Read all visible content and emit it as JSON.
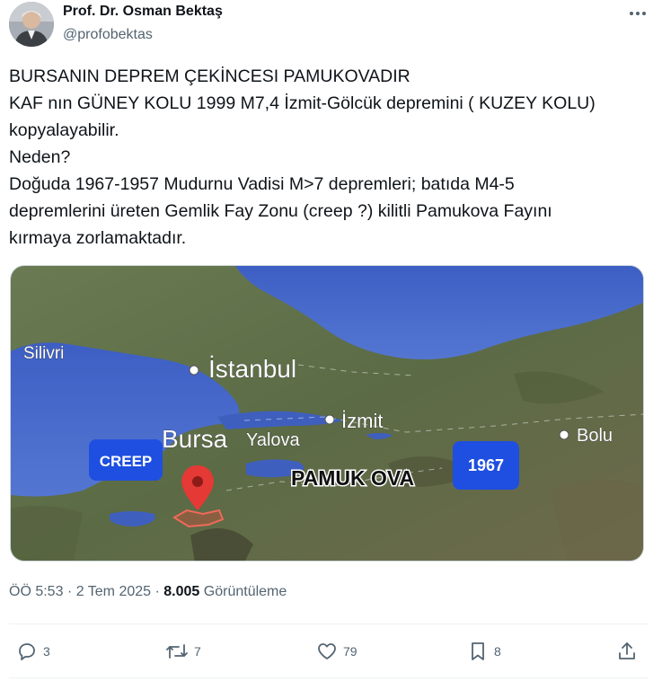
{
  "author": {
    "name": "Prof. Dr. Osman Bektaş",
    "handle": "@profobektas"
  },
  "tweet": {
    "lines": [
      "BURSANIN DEPREM ÇEKİNCESI PAMUKOVADIR",
      "KAF nın GÜNEY KOLU 1999 M7,4 İzmit-Gölcük depremini ( KUZEY KOLU)",
      "kopyalayabilir.",
      "Neden?",
      "Doğuda 1967-1957 Mudurnu Vadisi M>7 depremleri; batıda M4-5",
      "depremlerini üreten Gemlik Fay Zonu (creep ?) kilitli Pamukova Fayını",
      "kırmaya zorlamaktadır."
    ]
  },
  "map": {
    "labels": {
      "silivri": "Silivri",
      "istanbul": "İstanbul",
      "izmit": "İzmit",
      "bursa": "Bursa",
      "yalova": "Yalova",
      "bolu": "Bolu",
      "pamukova": "PAMUK OVA",
      "creep": "CREEP",
      "year": "1967"
    },
    "colors": {
      "sea": "#4a6bc9",
      "land": "#5b6b45",
      "badge": "#1f4fe0",
      "pin": "#e53935"
    }
  },
  "meta": {
    "time": "ÖÖ 5:53",
    "separator": "·",
    "date": "2 Tem 2025",
    "views_count": "8.005",
    "views_label": "Görüntüleme"
  },
  "actions": {
    "replies": "3",
    "reposts": "7",
    "likes": "79",
    "bookmarks": "8"
  },
  "icons": [
    "more-icon",
    "reply-icon",
    "repost-icon",
    "like-icon",
    "bookmark-icon",
    "share-icon",
    "location-pin-icon"
  ]
}
